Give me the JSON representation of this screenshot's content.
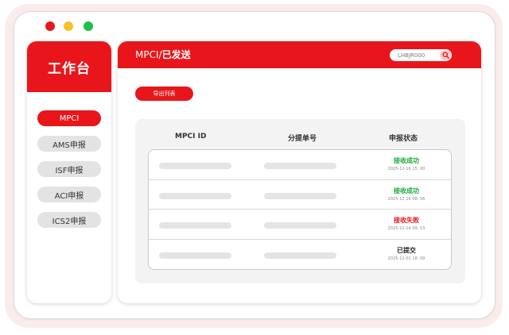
{
  "sidebar": {
    "title": "工作台",
    "items": [
      {
        "label": "MPCI",
        "active": true
      },
      {
        "label": "AMS申报",
        "active": false
      },
      {
        "label": "ISF申报",
        "active": false
      },
      {
        "label": "ACI申报",
        "active": false
      },
      {
        "label": "ICS2申报",
        "active": false
      }
    ]
  },
  "header": {
    "breadcrumb_parent": "MPCI/",
    "breadcrumb_current": "已发送",
    "search_value": "LHBJR000",
    "search_icon": "search-icon"
  },
  "toolbar": {
    "export_label": "导出列表"
  },
  "table": {
    "columns": [
      "MPCI ID",
      "分提单号",
      "申报状态"
    ],
    "rows": [
      {
        "status": "接收成功",
        "status_color": "#1aaa3c",
        "timestamp": "2025-12-16 15: 00"
      },
      {
        "status": "接收成功",
        "status_color": "#1aaa3c",
        "timestamp": "2025-12-16 08: 56"
      },
      {
        "status": "接收失败",
        "status_color": "#e8161b",
        "timestamp": "2025-12-14 09: 53"
      },
      {
        "status": "已提交",
        "status_color": "#222222",
        "timestamp": "2025-12-01 18: 09"
      }
    ]
  },
  "colors": {
    "accent": "#e8161b",
    "window_dot_red": "#e8171c",
    "window_dot_yellow": "#f5c12a",
    "window_dot_green": "#1ec04a"
  }
}
